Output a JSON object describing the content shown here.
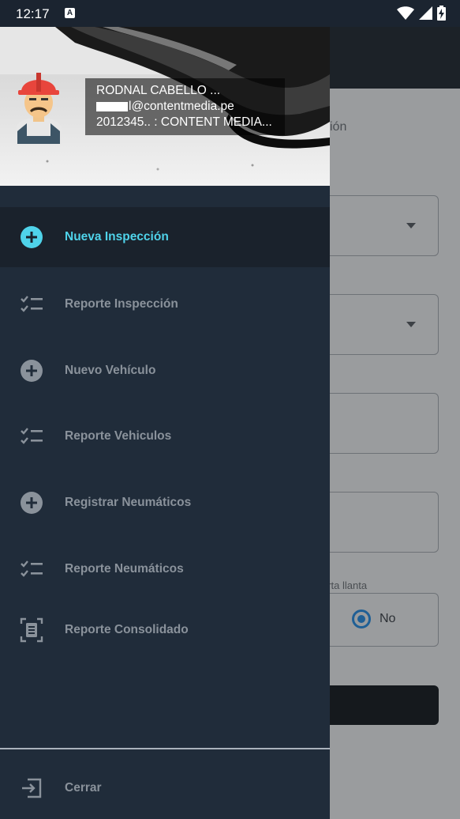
{
  "status_bar": {
    "time": "12:17",
    "notification_glyph": "A"
  },
  "background_app": {
    "partial_text": "ión",
    "partial_label": "orta llanta",
    "radio_no_label": "No"
  },
  "profile": {
    "name": "RODNAL CABELLO ...",
    "email": "l@contentmedia.pe",
    "company": "2012345.. : CONTENT MEDIA..."
  },
  "menu": {
    "items": [
      {
        "label": "Nueva Inspección",
        "icon": "add-circle-icon",
        "active": true
      },
      {
        "label": "Reporte Inspección",
        "icon": "checklist-icon",
        "active": false
      },
      {
        "label": "Nuevo Vehículo",
        "icon": "add-circle-icon",
        "active": false
      },
      {
        "label": "Reporte Vehiculos",
        "icon": "checklist-icon",
        "active": false
      },
      {
        "label": "Registrar Neumáticos",
        "icon": "add-circle-icon",
        "active": false
      },
      {
        "label": "Reporte Neumáticos",
        "icon": "checklist-icon",
        "active": false
      },
      {
        "label": "Reporte Consolidado",
        "icon": "document-scan-icon",
        "active": false
      }
    ],
    "logout_label": "Cerrar"
  },
  "colors": {
    "accent": "#4fd3ea",
    "drawer_bg": "#202c3a",
    "active_bg": "#1a222c",
    "inactive_text": "#8a929b"
  }
}
